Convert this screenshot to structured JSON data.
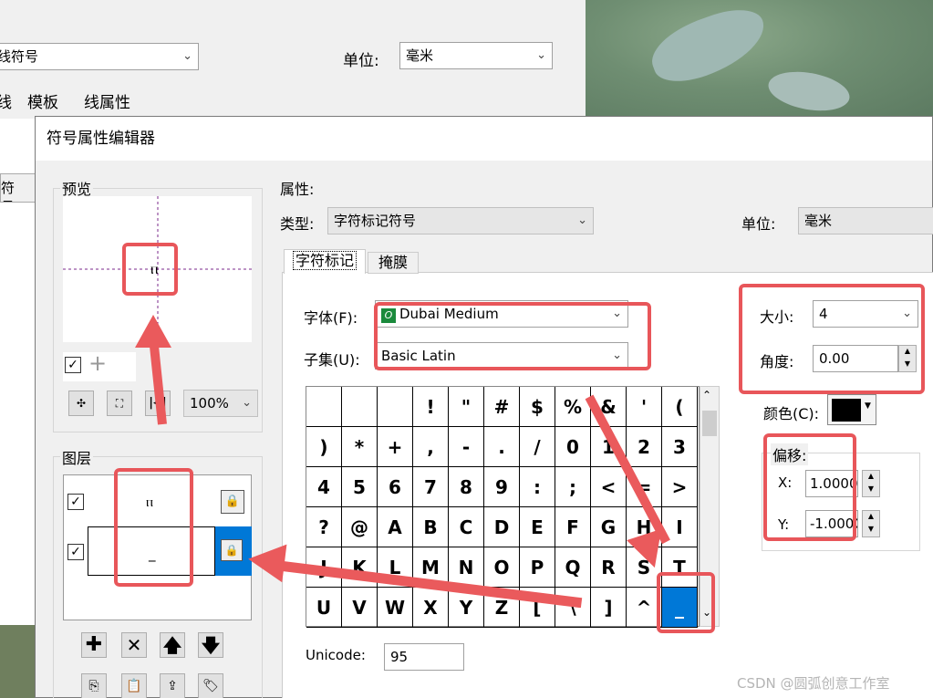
{
  "bg": {
    "symbol_type": "线符号",
    "unit_label": "单位:",
    "unit_value": "毫米",
    "tabs": [
      "线",
      "模板",
      "线属性"
    ],
    "left_label": "符号..."
  },
  "dialog": {
    "title": "符号属性编辑器",
    "preview_label": "预览",
    "preview_glyph": "ⲡ",
    "zoom": "100%",
    "layers_label": "图层",
    "layers": [
      {
        "glyph": "ⲡ",
        "checked": true
      },
      {
        "glyph": "_",
        "checked": true
      }
    ],
    "props_label": "属性:",
    "type_label": "类型:",
    "type_value": "字符标记符号",
    "unit_label": "单位:",
    "unit_value": "毫米",
    "tabs": [
      "字符标记",
      "掩膜"
    ],
    "font_label": "字体(F):",
    "font_value": "Dubai Medium",
    "subset_label": "子集(U):",
    "subset_value": "Basic Latin",
    "size_label": "大小:",
    "size_value": "4",
    "angle_label": "角度:",
    "angle_value": "0.00",
    "color_label": "颜色(C):",
    "color_value": "#000000",
    "offset_label": "偏移:",
    "x_label": "X:",
    "x_value": "1.0000",
    "y_label": "Y:",
    "y_value": "-1.0000",
    "unicode_label": "Unicode:",
    "unicode_value": "95",
    "chars": [
      " ",
      " ",
      " ",
      "!",
      "\"",
      "#",
      "$",
      "%",
      "&",
      "'",
      "(",
      ")",
      "*",
      "+",
      ",",
      "-",
      ".",
      "/",
      "0",
      "1",
      "2",
      "3",
      "4",
      "5",
      "6",
      "7",
      "8",
      "9",
      ":",
      ";",
      "<",
      "=",
      ">",
      "?",
      "@",
      "A",
      "B",
      "C",
      "D",
      "E",
      "F",
      "G",
      "H",
      "I",
      "J",
      "K",
      "L",
      "M",
      "N",
      "O",
      "P",
      "Q",
      "R",
      "S",
      "T",
      "U",
      "V",
      "W",
      "X",
      "Y",
      "Z",
      "[",
      "\\",
      "]",
      "^",
      "_"
    ],
    "selected_char": "_"
  },
  "watermark": "CSDN @圆弧创意工作室"
}
